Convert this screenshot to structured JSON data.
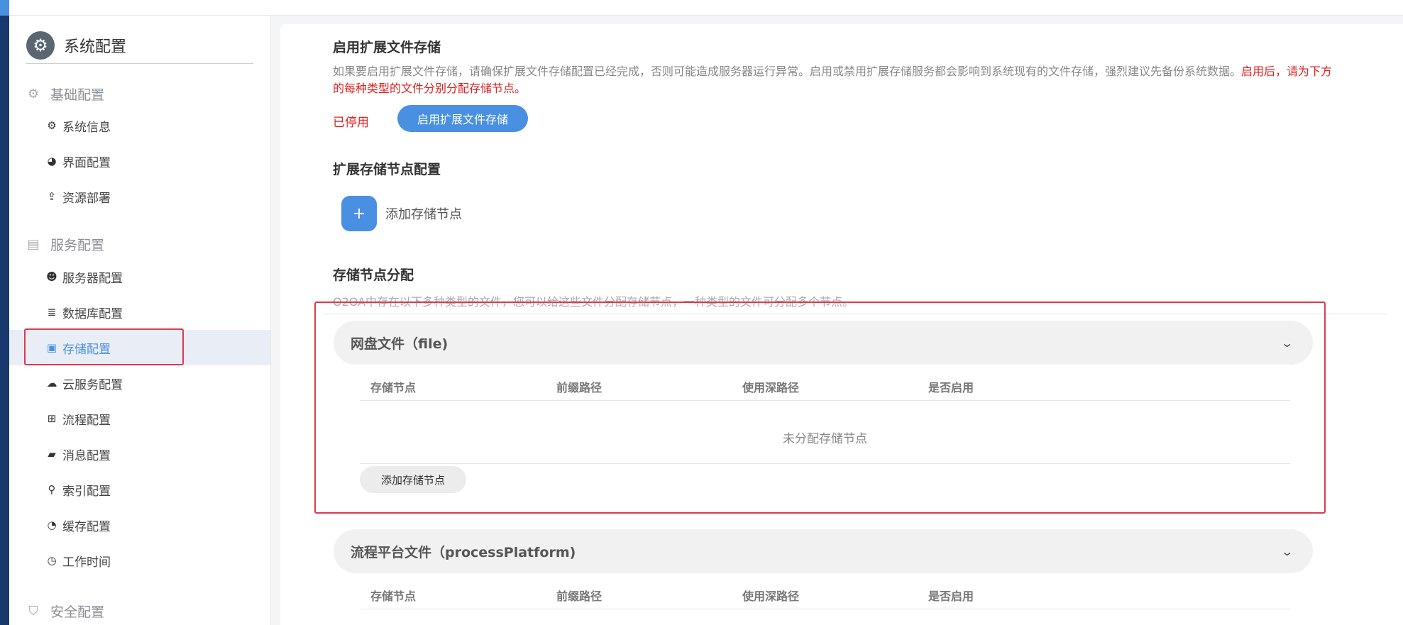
{
  "sidebar": {
    "title": "系统配置",
    "groups": [
      {
        "label": "基础配置",
        "icon": "gear-icon"
      },
      {
        "label": "服务配置",
        "icon": "server-icon"
      },
      {
        "label": "安全配置",
        "icon": "shield-icon"
      }
    ],
    "items": [
      {
        "label": "系统信息",
        "icon": "gear-icon"
      },
      {
        "label": "界面配置",
        "icon": "palette-icon"
      },
      {
        "label": "资源部署",
        "icon": "upload-icon"
      },
      {
        "label": "服务器配置",
        "icon": "server-user-icon"
      },
      {
        "label": "数据库配置",
        "icon": "database-icon"
      },
      {
        "label": "存储配置",
        "icon": "storage-icon",
        "active": true
      },
      {
        "label": "云服务配置",
        "icon": "cloud-icon"
      },
      {
        "label": "流程配置",
        "icon": "flow-icon"
      },
      {
        "label": "消息配置",
        "icon": "message-icon"
      },
      {
        "label": "索引配置",
        "icon": "search-icon"
      },
      {
        "label": "缓存配置",
        "icon": "pie-icon"
      },
      {
        "label": "工作时间",
        "icon": "stopwatch-icon"
      }
    ]
  },
  "main": {
    "ext_storage": {
      "title": "启用扩展文件存储",
      "desc": "如果要启用扩展文件存储，请确保扩展文件存储配置已经完成，否则可能造成服务器运行异常。启用或禁用扩展存储服务都会影响到系统现有的文件存储，强烈建议先备份系统数据。",
      "warning": "启用后，请为下方的每种类型的文件分别分配存储节点。",
      "status": "已停用",
      "enable_button": "启用扩展文件存储"
    },
    "node_config": {
      "title": "扩展存储节点配置",
      "plus": "+",
      "add_label": "添加存储节点"
    },
    "assignment": {
      "title": "存储节点分配",
      "desc": "O2OA中存在以下多种类型的文件，您可以给这些文件分配存储节点，一种类型的文件可分配多个节点。",
      "columns": [
        "存储节点",
        "前缀路径",
        "使用深路径",
        "是否启用"
      ],
      "panels": [
        {
          "title": "网盘文件（file)",
          "empty_text": "未分配存储节点",
          "add_button": "添加存储节点"
        },
        {
          "title": "流程平台文件（processPlatform)"
        }
      ]
    }
  },
  "colors": {
    "accent": "#4a90e2",
    "warning": "#e02020",
    "highlight_box": "#e0384f",
    "rail": "#17396b"
  }
}
